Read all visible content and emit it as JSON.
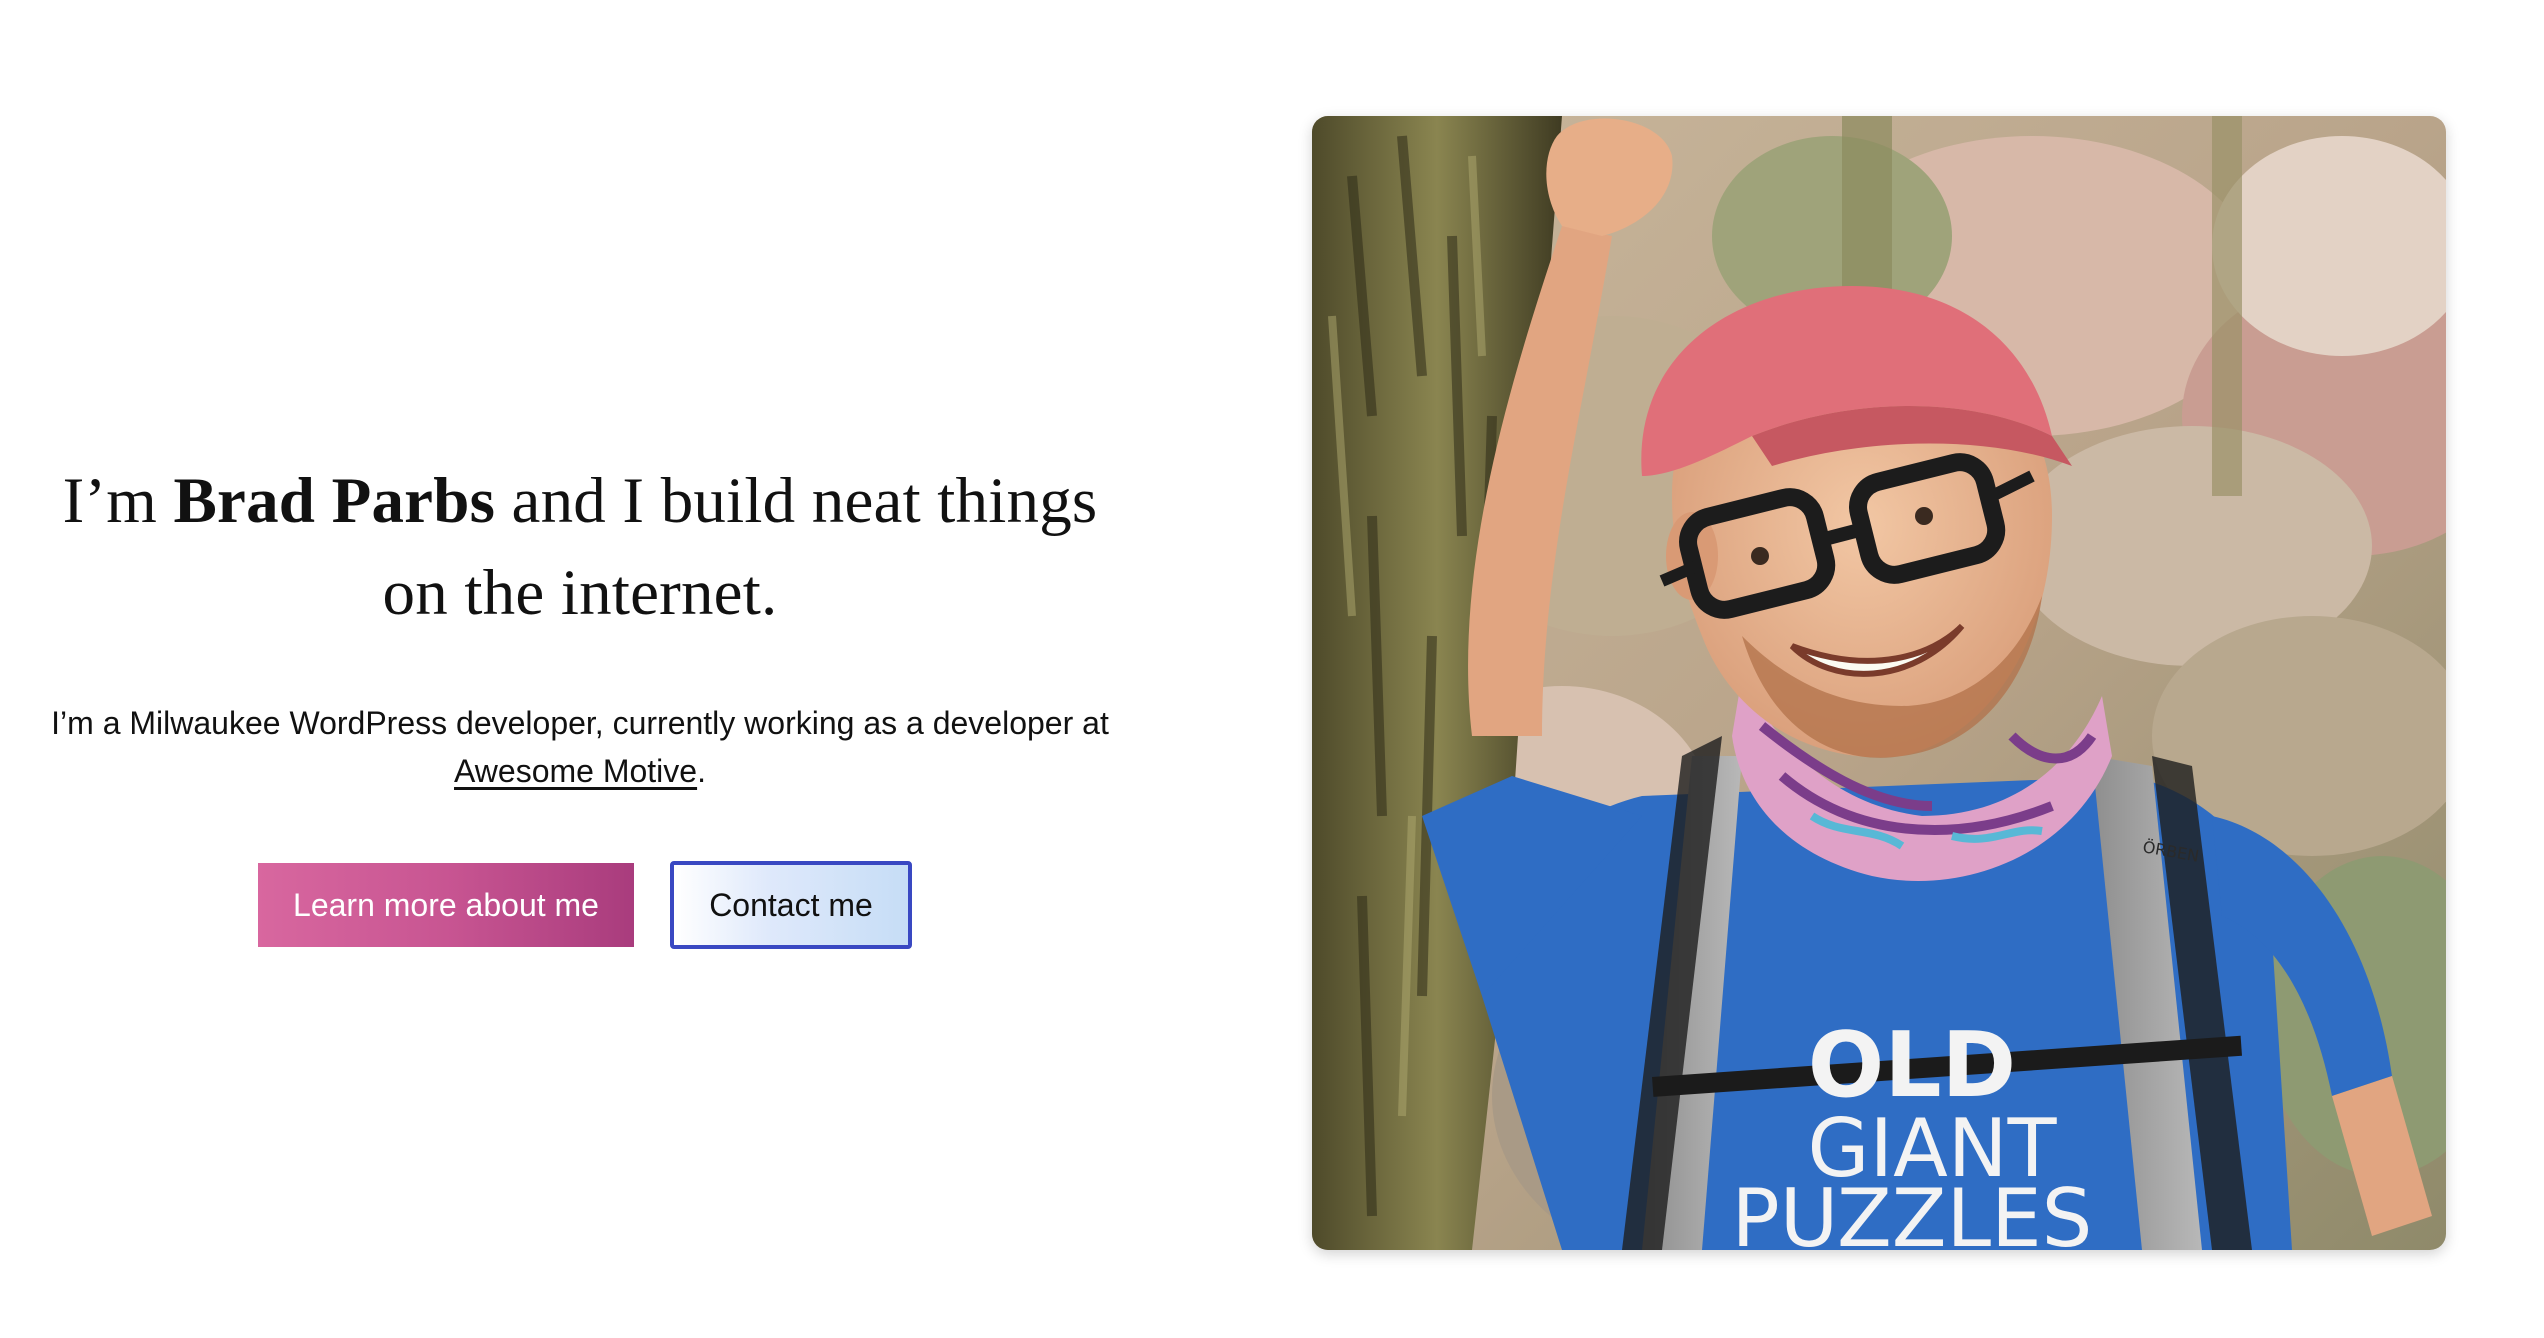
{
  "hero": {
    "headline_prefix": "I’m ",
    "headline_name": "Brad Parbs",
    "headline_suffix": " and I build neat things on the internet.",
    "intro_prefix": "I’m a Milwaukee WordPress developer, currently working as a developer at ",
    "intro_link": "Awesome Motive",
    "intro_suffix": "."
  },
  "buttons": {
    "learn_more": "Learn more about me",
    "contact": "Contact me"
  },
  "photo": {
    "shirt_text_top": "OLD",
    "shirt_text_mid": "GIANT",
    "shirt_text_bottom": "PUZZLES",
    "backpack_brand": "ÖRBEN"
  },
  "colors": {
    "primary_button": "#c85592",
    "secondary_border": "#3948c2",
    "shirt": "#2f6dc4",
    "cap": "#e06f79"
  }
}
